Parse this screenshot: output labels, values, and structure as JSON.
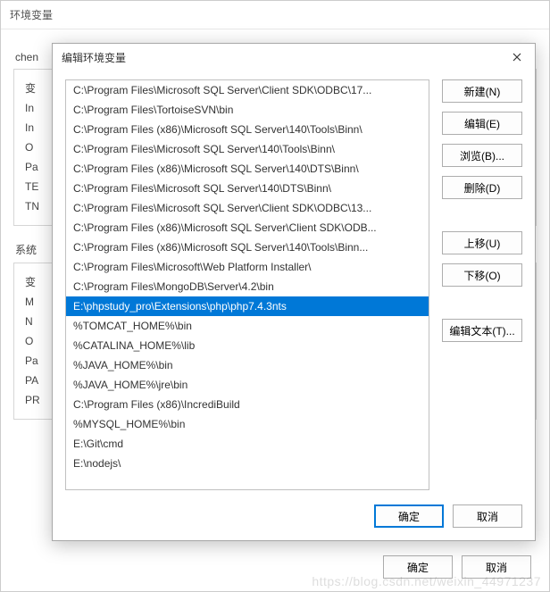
{
  "parent": {
    "title": "环境变量",
    "group1_label_prefix": "chen",
    "group1_lines": [
      "变",
      "In",
      "In",
      "O",
      "Pa",
      "TE",
      "TN"
    ],
    "group2_label": "系统",
    "group2_lines": [
      "变",
      "M",
      "N",
      "O",
      "Pa",
      "PA",
      "PR"
    ],
    "ok_label": "确定",
    "cancel_label": "取消"
  },
  "modal": {
    "title": "编辑环境变量",
    "list_items": [
      {
        "text": "C:\\Program Files\\Microsoft SQL Server\\Client SDK\\ODBC\\17...",
        "selected": false
      },
      {
        "text": "C:\\Program Files\\TortoiseSVN\\bin",
        "selected": false
      },
      {
        "text": "C:\\Program Files (x86)\\Microsoft SQL Server\\140\\Tools\\Binn\\",
        "selected": false
      },
      {
        "text": "C:\\Program Files\\Microsoft SQL Server\\140\\Tools\\Binn\\",
        "selected": false
      },
      {
        "text": "C:\\Program Files (x86)\\Microsoft SQL Server\\140\\DTS\\Binn\\",
        "selected": false
      },
      {
        "text": "C:\\Program Files\\Microsoft SQL Server\\140\\DTS\\Binn\\",
        "selected": false
      },
      {
        "text": "C:\\Program Files\\Microsoft SQL Server\\Client SDK\\ODBC\\13...",
        "selected": false
      },
      {
        "text": "C:\\Program Files (x86)\\Microsoft SQL Server\\Client SDK\\ODB...",
        "selected": false
      },
      {
        "text": "C:\\Program Files (x86)\\Microsoft SQL Server\\140\\Tools\\Binn...",
        "selected": false
      },
      {
        "text": "C:\\Program Files\\Microsoft\\Web Platform Installer\\",
        "selected": false
      },
      {
        "text": "C:\\Program Files\\MongoDB\\Server\\4.2\\bin",
        "selected": false
      },
      {
        "text": "E:\\phpstudy_pro\\Extensions\\php\\php7.4.3nts",
        "selected": true
      },
      {
        "text": "%TOMCAT_HOME%\\bin",
        "selected": false
      },
      {
        "text": "%CATALINA_HOME%\\lib",
        "selected": false
      },
      {
        "text": "%JAVA_HOME%\\bin",
        "selected": false
      },
      {
        "text": "%JAVA_HOME%\\jre\\bin",
        "selected": false
      },
      {
        "text": "C:\\Program Files (x86)\\IncrediBuild",
        "selected": false
      },
      {
        "text": "%MYSQL_HOME%\\bin",
        "selected": false
      },
      {
        "text": "E:\\Git\\cmd",
        "selected": false
      },
      {
        "text": "E:\\nodejs\\",
        "selected": false
      }
    ],
    "buttons": {
      "new": "新建(N)",
      "edit": "编辑(E)",
      "browse": "浏览(B)...",
      "delete": "删除(D)",
      "move_up": "上移(U)",
      "move_down": "下移(O)",
      "edit_text": "编辑文本(T)..."
    },
    "ok_label": "确定",
    "cancel_label": "取消"
  },
  "watermark": "https://blog.csdn.net/weixin_44971237"
}
